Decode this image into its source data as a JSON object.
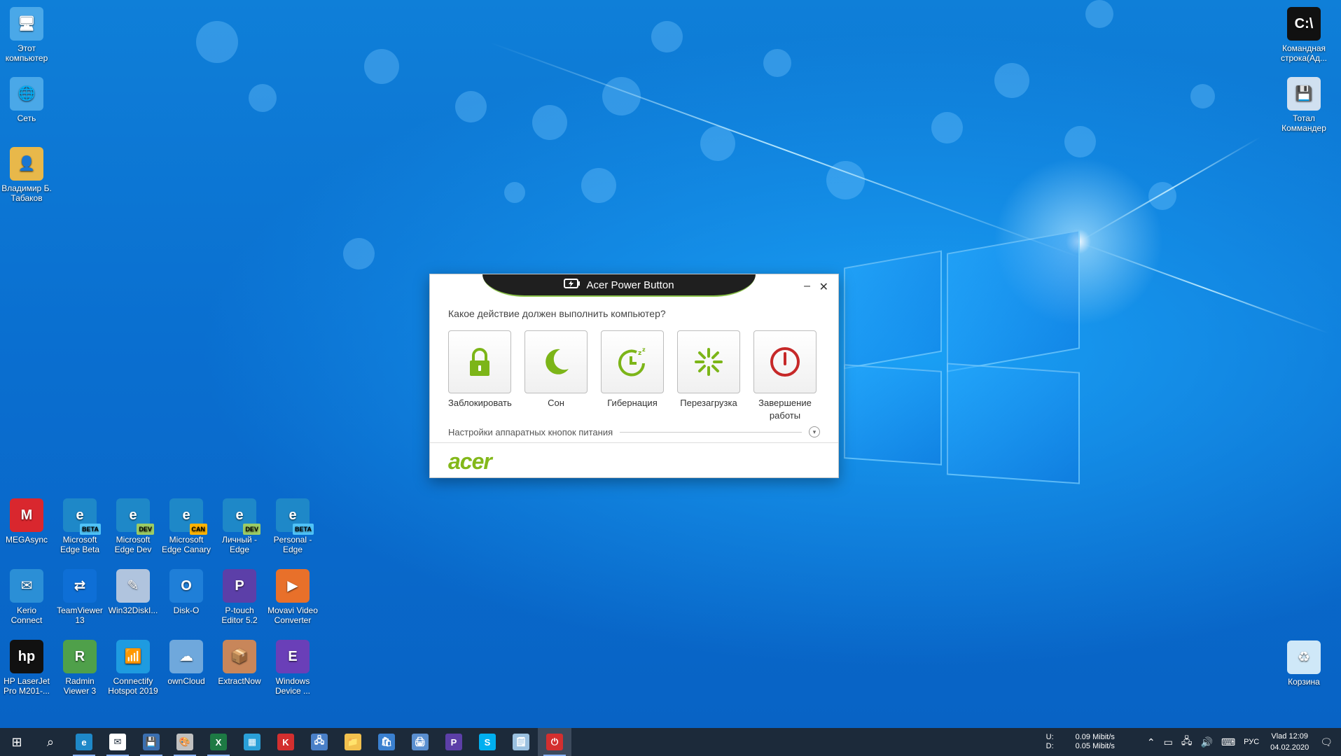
{
  "desktop": {
    "left_icons": [
      {
        "label": "Этот компьютер",
        "color": "#4aa8e8",
        "glyph": "🖥"
      },
      {
        "label": "Сеть",
        "color": "#4aa8e8",
        "glyph": "🌐"
      },
      {
        "label": "Владимир Б. Табаков",
        "color": "#e8b84a",
        "glyph": "👤"
      }
    ],
    "right_icons": [
      {
        "label": "Командная строка(Ад...",
        "color": "#111111",
        "glyph": "C:\\"
      },
      {
        "label": "Тотал Коммандер",
        "color": "#d0e0f0",
        "glyph": "💾"
      },
      {
        "label": "Корзина",
        "color": "#cfe8f8",
        "glyph": "♻"
      }
    ],
    "grid_icons": [
      {
        "label": "MEGAsync",
        "color": "#d9272e",
        "glyph": "M",
        "badge": ""
      },
      {
        "label": "Microsoft Edge Beta",
        "color": "#1e88c8",
        "glyph": "e",
        "badge": "BETA",
        "badge_color": "#4fc3f7"
      },
      {
        "label": "Microsoft Edge Dev",
        "color": "#1e88c8",
        "glyph": "e",
        "badge": "DEV",
        "badge_color": "#9ccc65"
      },
      {
        "label": "Microsoft Edge Canary",
        "color": "#1e88c8",
        "glyph": "e",
        "badge": "CAN",
        "badge_color": "#ffb300"
      },
      {
        "label": "Личный - Edge",
        "color": "#1e88c8",
        "glyph": "e",
        "badge": "DEV",
        "badge_color": "#9ccc65"
      },
      {
        "label": "Personal - Edge",
        "color": "#1e88c8",
        "glyph": "e",
        "badge": "BETA",
        "badge_color": "#4fc3f7"
      },
      {
        "label": "Kerio Connect",
        "color": "#2b8fd6",
        "glyph": "✉",
        "badge": ""
      },
      {
        "label": "TeamViewer 13",
        "color": "#0e6fd6",
        "glyph": "⇄",
        "badge": ""
      },
      {
        "label": "Win32DiskI...",
        "color": "#b0c4de",
        "glyph": "✎",
        "badge": ""
      },
      {
        "label": "Disk-O",
        "color": "#1f7fd8",
        "glyph": "O",
        "badge": ""
      },
      {
        "label": "P-touch Editor 5.2",
        "color": "#5c3fa8",
        "glyph": "P",
        "badge": ""
      },
      {
        "label": "Movavi Video Converter",
        "color": "#e8702a",
        "glyph": "▶",
        "badge": ""
      },
      {
        "label": "HP LaserJet Pro M201-...",
        "color": "#111111",
        "glyph": "hp",
        "badge": ""
      },
      {
        "label": "Radmin Viewer 3",
        "color": "#4fa04a",
        "glyph": "R",
        "badge": ""
      },
      {
        "label": "Connectify Hotspot 2019",
        "color": "#1e9be0",
        "glyph": "📶",
        "badge": ""
      },
      {
        "label": "ownCloud",
        "color": "#6fa8dc",
        "glyph": "☁",
        "badge": ""
      },
      {
        "label": "ExtractNow",
        "color": "#c8865a",
        "glyph": "📦",
        "badge": ""
      },
      {
        "label": "Windows Device ...",
        "color": "#6a3fb8",
        "glyph": "E",
        "badge": ""
      }
    ]
  },
  "dialog": {
    "title": "Acer Power Button",
    "minimize": "–",
    "close": "✕",
    "question": "Какое действие должен выполнить компьютер?",
    "actions": [
      {
        "label": "Заблокировать",
        "icon": "lock-icon"
      },
      {
        "label": "Сон",
        "icon": "moon-icon"
      },
      {
        "label": "Гибернация",
        "icon": "hibernate-icon"
      },
      {
        "label": "Перезагрузка",
        "icon": "restart-icon"
      },
      {
        "label": "Завершение работы",
        "icon": "power-icon"
      }
    ],
    "hw_settings": "Настройки аппаратных кнопок питания",
    "expand": "▾",
    "logo": "acer",
    "accent": "#83b81a"
  },
  "taskbar": {
    "apps": [
      {
        "name": "start",
        "glyph": "⊞",
        "color": ""
      },
      {
        "name": "search",
        "glyph": "⌕",
        "color": ""
      },
      {
        "name": "edge-canary",
        "glyph": "e",
        "color": "#1e88c8"
      },
      {
        "name": "mail",
        "glyph": "✉",
        "color": "#ffffff"
      },
      {
        "name": "save",
        "glyph": "💾",
        "color": "#3a6fb0"
      },
      {
        "name": "paint",
        "glyph": "🎨",
        "color": "#c0c0c0"
      },
      {
        "name": "excel",
        "glyph": "X",
        "color": "#1d7a44"
      },
      {
        "name": "azure-storage",
        "glyph": "▦",
        "color": "#2aa0d8"
      },
      {
        "name": "kaspersky",
        "glyph": "K",
        "color": "#d32f2f"
      },
      {
        "name": "remote-desktop",
        "glyph": "🖧",
        "color": "#4a80c8"
      },
      {
        "name": "explorer",
        "glyph": "📁",
        "color": "#f2c14e"
      },
      {
        "name": "store",
        "glyph": "🛍",
        "color": "#3a80d0"
      },
      {
        "name": "printer",
        "glyph": "🖨",
        "color": "#5a8fd0"
      },
      {
        "name": "p-touch",
        "glyph": "P",
        "color": "#5c3fa8"
      },
      {
        "name": "skype",
        "glyph": "S",
        "color": "#00aff0"
      },
      {
        "name": "notes",
        "glyph": "🗒",
        "color": "#9ac0e0"
      },
      {
        "name": "acer-power-button",
        "glyph": "⏻",
        "color": "#d32f2f"
      }
    ],
    "net_up_label": "U:",
    "net_up_value": "0.09 Mibit/s",
    "net_down_label": "D:",
    "net_down_value": "0.05 Mibit/s",
    "language": "РУС",
    "user": "Vlad",
    "time": "12:09",
    "date": "04.02.2020"
  }
}
